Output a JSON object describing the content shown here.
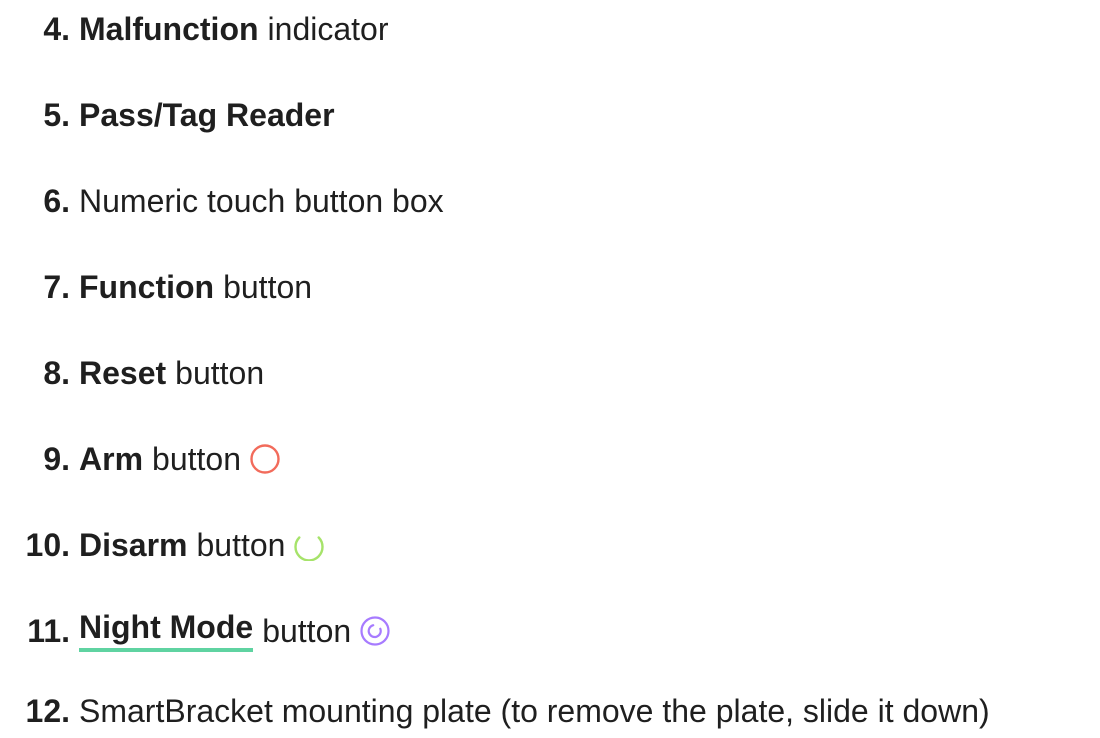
{
  "items": [
    {
      "number": "4.",
      "label": "Malfunction",
      "rest": "indicator"
    },
    {
      "number": "5.",
      "label": "Pass/Tag Reader",
      "rest": ""
    },
    {
      "number": "6.",
      "label": "",
      "rest": "Numeric touch button box"
    },
    {
      "number": "7.",
      "label": "Function",
      "rest": "button"
    },
    {
      "number": "8.",
      "label": "Reset",
      "rest": "button"
    },
    {
      "number": "9.",
      "label": "Arm",
      "rest": "button",
      "icon": "arm-circle-icon",
      "color": "#f26b5b"
    },
    {
      "number": "10.",
      "label": "Disarm",
      "rest": "button",
      "icon": "disarm-open-circle-icon",
      "color": "#a6e36a"
    },
    {
      "number": "11.",
      "label": "Night Mode",
      "rest": "button",
      "icon": "night-mode-circle-icon",
      "color": "#a77bff",
      "link_underline_color": "#5fd3a1"
    },
    {
      "number": "12.",
      "label": "",
      "rest": "SmartBracket mounting plate (to remove the plate, slide it down)"
    }
  ]
}
